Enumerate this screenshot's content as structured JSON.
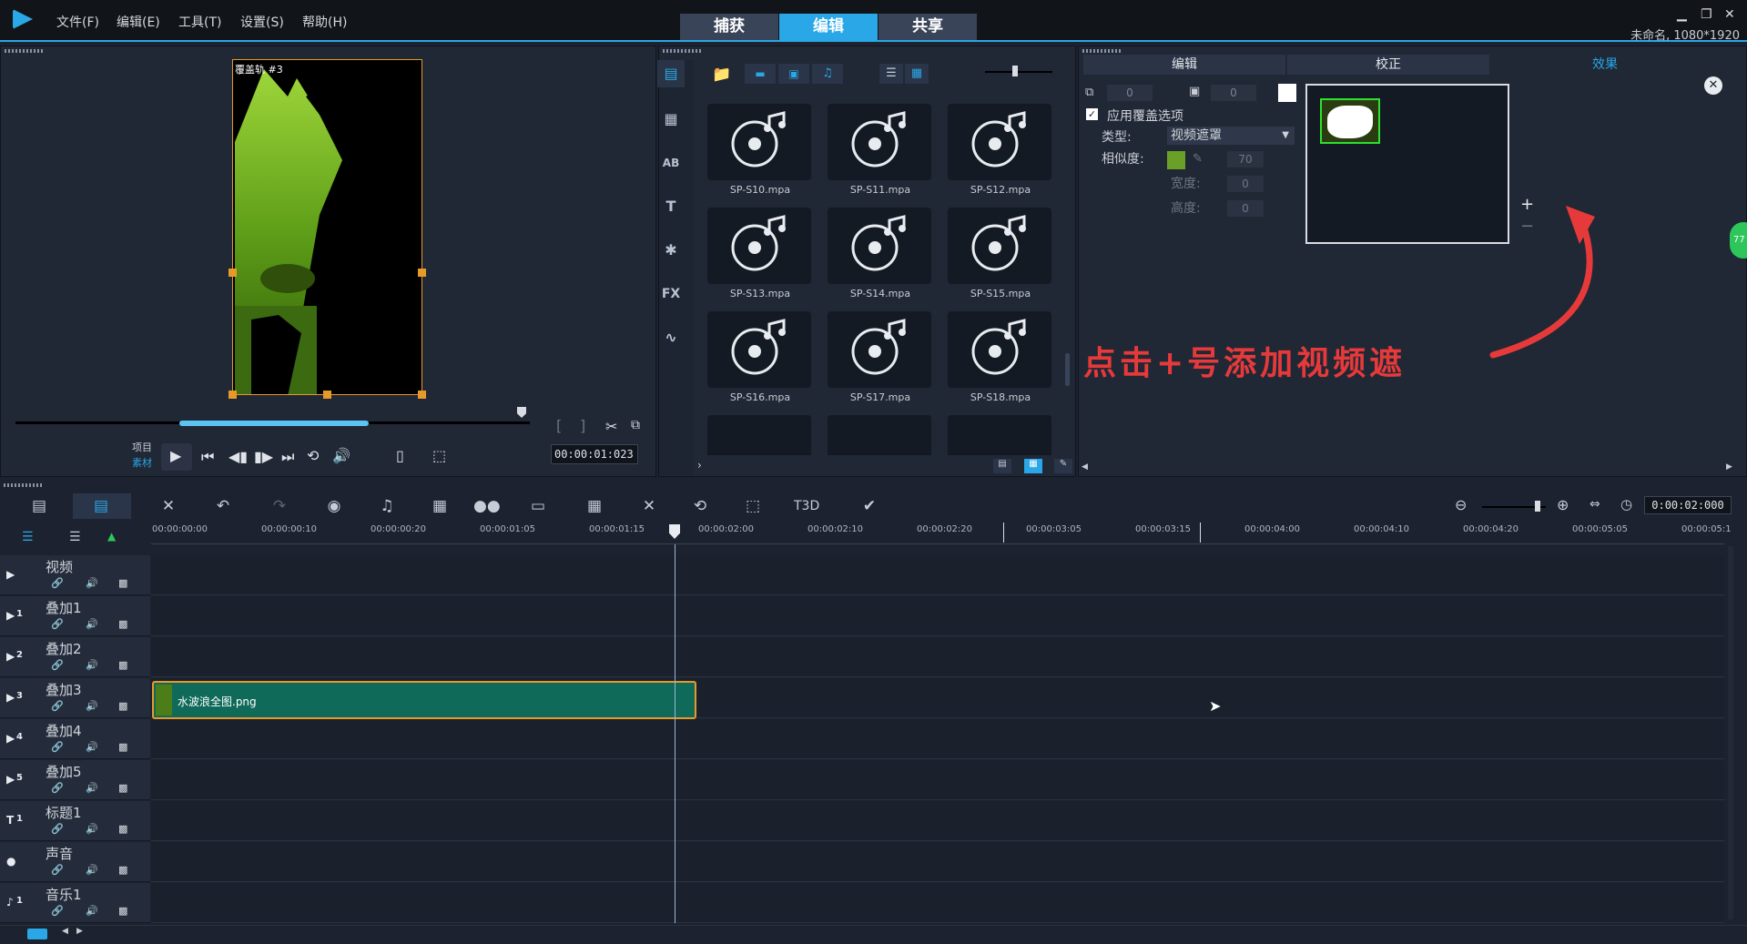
{
  "menu": {
    "items": [
      "文件(F)",
      "编辑(E)",
      "工具(T)",
      "设置(S)",
      "帮助(H)"
    ]
  },
  "modes": {
    "capture": "捕获",
    "edit": "编辑",
    "share": "共享"
  },
  "project_info": "未命名, 1080*1920",
  "player": {
    "overlay_label": "覆盖轨 #3",
    "project_label": "项目",
    "clip_label": "素材",
    "timecode": "00:00:01:023"
  },
  "library": {
    "items": [
      "SP-S10.mpa",
      "SP-S11.mpa",
      "SP-S12.mpa",
      "SP-S13.mpa",
      "SP-S14.mpa",
      "SP-S15.mpa",
      "SP-S16.mpa",
      "SP-S17.mpa",
      "SP-S18.mpa"
    ]
  },
  "options": {
    "tabs": [
      "编辑",
      "校正",
      "效果"
    ],
    "num1": "0",
    "num2": "0",
    "apply_overlay": "应用覆盖选项",
    "type_label": "类型:",
    "type_value": "视频遮罩",
    "similarity_label": "相似度:",
    "similarity_value": "70",
    "width_label": "宽度:",
    "width_value": "0",
    "height_label": "高度:",
    "height_value": "0",
    "plus": "+",
    "minus": "−",
    "annotation": "点击+号添加视频遮",
    "side_badge": "77",
    "accent": "#2aa7e6"
  },
  "timeline": {
    "zoom_timecode": "0:00:02:000",
    "ruler": [
      "00:00:00:00",
      "00:00:00:10",
      "00:00:00:20",
      "00:00:01:05",
      "00:00:01:15",
      "00:00:02:00",
      "00:00:02:10",
      "00:00:02:20",
      "00:00:03:05",
      "00:00:03:15",
      "00:00:04:00",
      "00:00:04:10",
      "00:00:04:20",
      "00:00:05:05",
      "00:00:05:1"
    ],
    "tracks": [
      {
        "name": "视频",
        "icon": "▶",
        "num": ""
      },
      {
        "name": "叠加1",
        "icon": "▶",
        "num": "1"
      },
      {
        "name": "叠加2",
        "icon": "▶",
        "num": "2"
      },
      {
        "name": "叠加3",
        "icon": "▶",
        "num": "3"
      },
      {
        "name": "叠加4",
        "icon": "▶",
        "num": "4"
      },
      {
        "name": "叠加5",
        "icon": "▶",
        "num": "5"
      },
      {
        "name": "标题1",
        "icon": "T",
        "num": "1"
      },
      {
        "name": "声音",
        "icon": "●",
        "num": ""
      },
      {
        "name": "音乐1",
        "icon": "♪",
        "num": "1"
      }
    ],
    "clip_name": "水波浪全图.png"
  }
}
